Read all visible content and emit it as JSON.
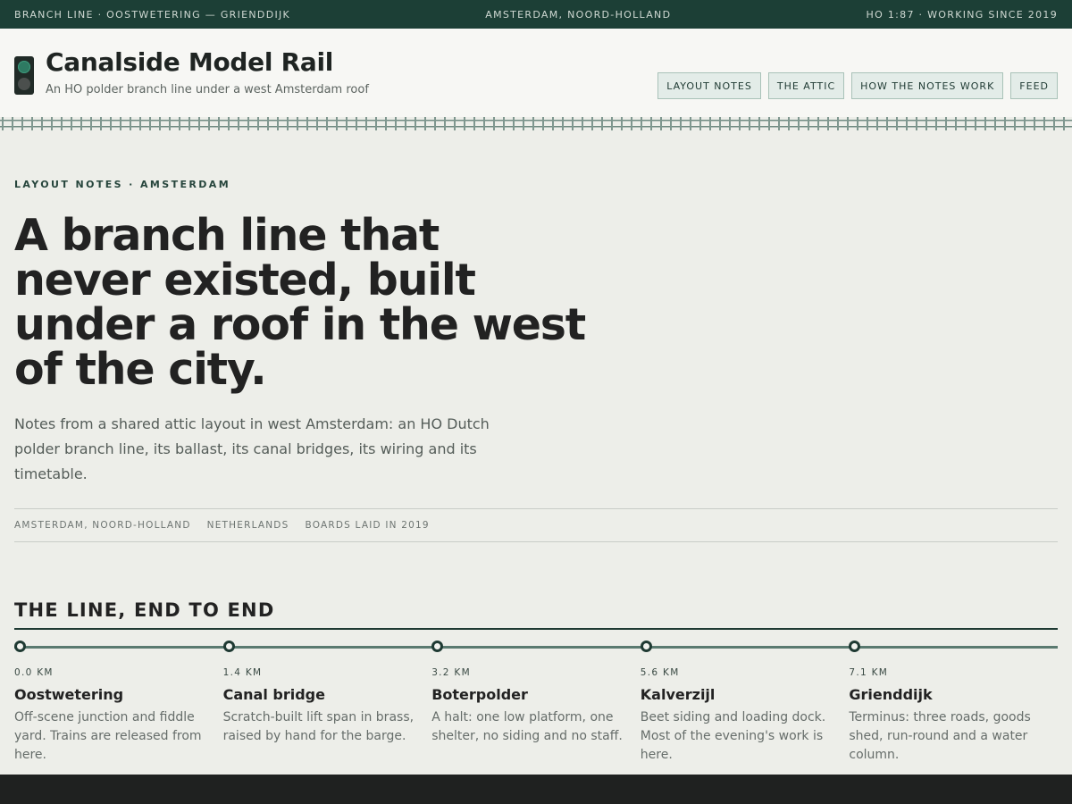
{
  "topbar": {
    "left": "BRANCH LINE · OOSTWETERING — GRIENDDIJK",
    "center": "AMSTERDAM, NOORD-HOLLAND",
    "right": "HO 1:87 · WORKING SINCE 2019"
  },
  "header": {
    "title": "Canalside Model Rail",
    "subtitle": "An HO polder branch line under a west Amsterdam roof",
    "logo_icon": "signal-lamp-icon"
  },
  "nav": {
    "items": [
      {
        "label": "LAYOUT NOTES"
      },
      {
        "label": "THE ATTIC"
      },
      {
        "label": "HOW THE NOTES WORK"
      },
      {
        "label": "FEED"
      }
    ]
  },
  "hero": {
    "kicker": "LAYOUT NOTES · AMSTERDAM",
    "headline": "A branch line that never existed, built under a roof in the west of the city.",
    "lede": "Notes from a shared attic layout in west Amsterdam: an HO Dutch polder branch line, its ballast, its canal bridges, its wiring and its timetable.",
    "meta": [
      "AMSTERDAM, NOORD-HOLLAND",
      "NETHERLANDS",
      "BOARDS LAID IN 2019"
    ]
  },
  "line": {
    "title": "THE LINE, END TO END",
    "stops": [
      {
        "km": "0.0 KM",
        "name": "Oostwetering",
        "desc": "Off-scene junction and fiddle yard. Trains are released from here."
      },
      {
        "km": "1.4 KM",
        "name": "Canal bridge",
        "desc": "Scratch-built lift span in brass, raised by hand for the barge."
      },
      {
        "km": "3.2 KM",
        "name": "Boterpolder",
        "desc": "A halt: one low platform, one shelter, no siding and no staff."
      },
      {
        "km": "5.6 KM",
        "name": "Kalverzijl",
        "desc": "Beet siding and loading dock. Most of the evening's work is here."
      },
      {
        "km": "7.1 KM",
        "name": "Grienddijk",
        "desc": "Terminus: three roads, goods shed, run-round and a water column."
      }
    ]
  },
  "colors": {
    "topbar_bg": "#1c3f36",
    "accent": "#1f3a33",
    "signal_green": "#2e7a62",
    "page_bg": "#edeee9",
    "footer_bg": "#1f2120"
  }
}
